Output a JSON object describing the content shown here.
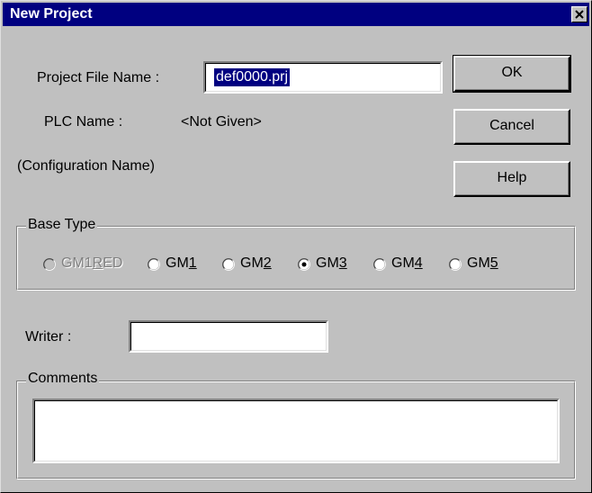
{
  "window": {
    "title": "New Project"
  },
  "form": {
    "project_file_label": "Project File Name :",
    "project_file_value": "def0000.prj",
    "plc_label": "PLC Name :",
    "plc_value": "<Not Given>",
    "config_label": "(Configuration Name)",
    "writer_label": "Writer :",
    "writer_value": "",
    "comments_value": ""
  },
  "buttons": {
    "ok": "OK",
    "cancel": "Cancel",
    "help": "Help"
  },
  "base_type": {
    "title": "Base Type",
    "options": [
      {
        "pre": "GM1",
        "u": "R",
        "post": "ED",
        "checked": false,
        "disabled": true
      },
      {
        "pre": "GM",
        "u": "1",
        "post": "",
        "checked": false,
        "disabled": false
      },
      {
        "pre": "GM",
        "u": "2",
        "post": "",
        "checked": false,
        "disabled": false
      },
      {
        "pre": "GM",
        "u": "3",
        "post": "",
        "checked": true,
        "disabled": false
      },
      {
        "pre": "GM",
        "u": "4",
        "post": "",
        "checked": false,
        "disabled": false
      },
      {
        "pre": "GM",
        "u": "5",
        "post": "",
        "checked": false,
        "disabled": false
      }
    ]
  },
  "comments": {
    "title": "Comments"
  },
  "colors": {
    "titlebar": "#000080",
    "face": "#c0c0c0",
    "selection": "#000080"
  }
}
